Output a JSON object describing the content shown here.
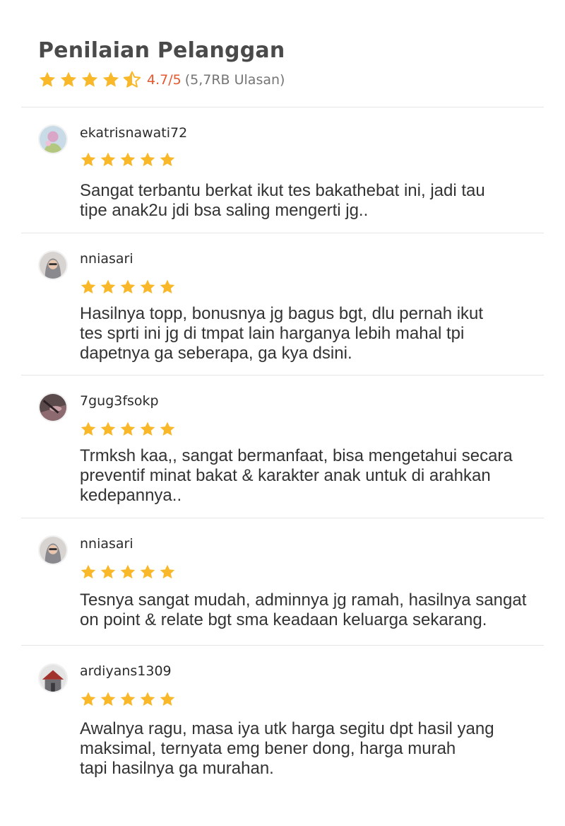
{
  "header": {
    "title": "Penilaian Pelanggan",
    "rating": "4.7/5",
    "rating_stars": 4.7,
    "review_count": "(5,7RB Ulasan)"
  },
  "colors": {
    "star": "#f9b82a",
    "rating_accent": "#e7582f"
  },
  "reviews": [
    {
      "username": "ekatrisnawati72",
      "stars": 5,
      "text": "Sangat terbantu berkat ikut tes bakathebat ini, jadi tau\ntipe anak2u jdi bsa saling mengerti jg.."
    },
    {
      "username": "nniasari",
      "stars": 5,
      "text": "Hasilnya topp, bonusnya jg bagus bgt, dlu pernah ikut\ntes sprti ini jg di tmpat lain harganya lebih mahal tpi\ndapetnya ga seberapa, ga kya dsini."
    },
    {
      "username": "7gug3fsokp",
      "stars": 5,
      "text": "Trmksh kaa,, sangat bermanfaat, bisa mengetahui secara\npreventif minat bakat & karakter anak untuk di arahkan\nkedepannya.."
    },
    {
      "username": "nniasari",
      "stars": 5,
      "text": "Tesnya sangat mudah, adminnya jg ramah, hasilnya sangat\non point & relate bgt sma keadaan keluarga sekarang."
    },
    {
      "username": "ardiyans1309",
      "stars": 5,
      "text": "Awalnya ragu, masa iya utk harga segitu dpt hasil yang\nmaksimal, ternyata emg bener dong, harga murah\ntapi hasilnya ga murahan."
    }
  ]
}
